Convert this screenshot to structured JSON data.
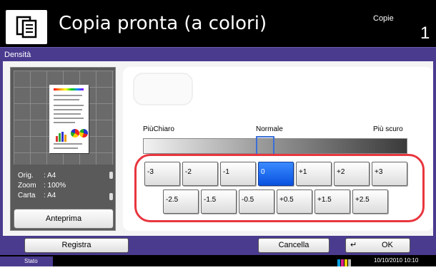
{
  "header": {
    "title": "Copia pronta (a colori)",
    "copies_label": "Copie",
    "copies_value": "1",
    "icon": "copy-icon"
  },
  "panel_title": "Densità",
  "preview": {
    "rows": [
      {
        "key": "Orig.",
        "value": ": A4"
      },
      {
        "key": "Zoom",
        "value": ": 100%"
      },
      {
        "key": "Carta",
        "value": ": A4"
      }
    ],
    "button_label": "Anteprima"
  },
  "density": {
    "label_left": "PiùChiaro",
    "label_center": "Normale",
    "label_right": "Più scuro",
    "selected": "0",
    "row1": [
      "-3",
      "-2",
      "-1",
      "0",
      "+1",
      "+2",
      "+3"
    ],
    "row2": [
      "-2.5",
      "-1.5",
      "-0.5",
      "+0.5",
      "+1.5",
      "+2.5"
    ]
  },
  "bottom": {
    "register_label": "Registra",
    "cancel_label": "Cancella",
    "ok_label": "OK"
  },
  "statusbar": {
    "status_label": "Stato",
    "datetime": "10/10/2010  10:10"
  },
  "colors": {
    "accent": "#4a3b8f",
    "selected_button": "#0a52e0",
    "highlight_frame": "#e8363f"
  }
}
